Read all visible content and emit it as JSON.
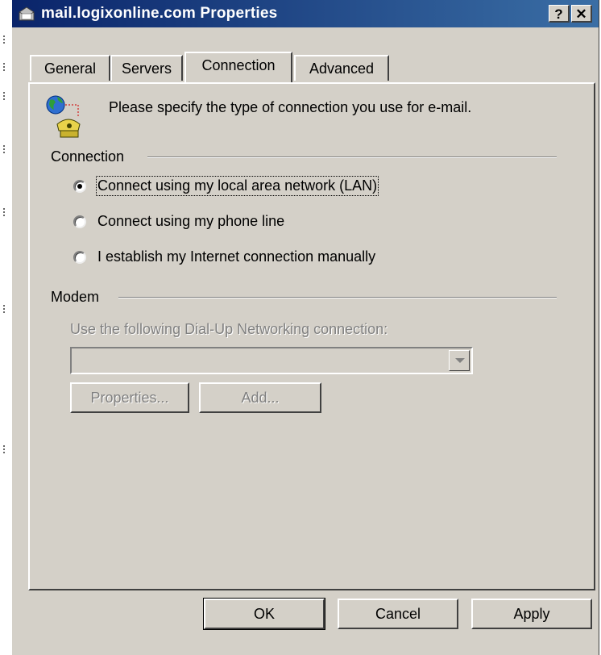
{
  "window": {
    "title": "mail.logixonline.com Properties",
    "help_button": "?",
    "close_button": "✕"
  },
  "tabs": [
    {
      "label": "General"
    },
    {
      "label": "Servers"
    },
    {
      "label": "Connection",
      "active": true
    },
    {
      "label": "Advanced"
    }
  ],
  "content": {
    "hint": "Please specify the type of connection you use for e-mail.",
    "connection_group": {
      "label": "Connection",
      "options": [
        {
          "label": "Connect using my local area network (LAN)",
          "selected": true
        },
        {
          "label": "Connect using my phone line",
          "selected": false
        },
        {
          "label": "I establish my Internet connection manually",
          "selected": false
        }
      ]
    },
    "modem_group": {
      "label": "Modem",
      "dialup_label": "Use the following Dial-Up Networking connection:",
      "dialup_value": "",
      "properties_button": "Properties...",
      "add_button": "Add..."
    }
  },
  "footer": {
    "ok": "OK",
    "cancel": "Cancel",
    "apply": "Apply"
  },
  "colors": {
    "dialog_bg": "#d4d0c8",
    "title_start": "#0a246a",
    "title_end": "#3a6ea5",
    "disabled_text": "#808080"
  }
}
